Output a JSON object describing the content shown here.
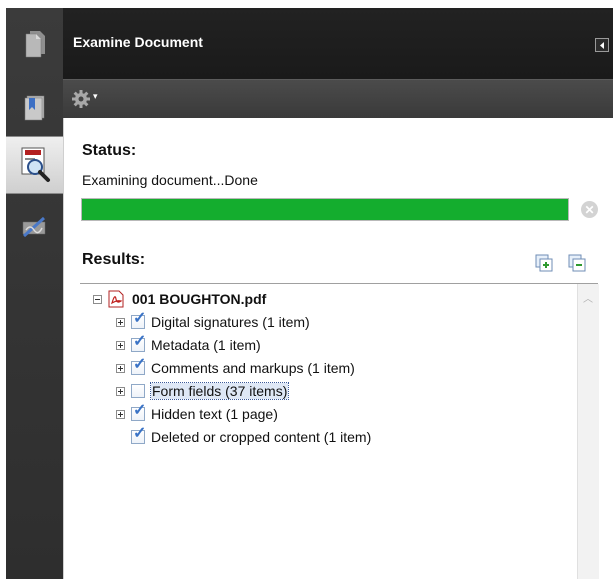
{
  "rail": {
    "items": [
      {
        "name": "page-thumbnails",
        "icon": "page-thumbnails-icon"
      },
      {
        "name": "bookmarks",
        "icon": "bookmarks-icon"
      },
      {
        "name": "examine-document",
        "icon": "examine-document-icon",
        "active": true
      },
      {
        "name": "signatures",
        "icon": "signatures-icon"
      }
    ]
  },
  "panel": {
    "title": "Examine Document",
    "collapse_icon": "collapse-arrow-icon",
    "options_icon": "gear-icon"
  },
  "status": {
    "label": "Status:",
    "message": "Examining document...Done",
    "progress": 1.0,
    "progress_color": "#14ad2e"
  },
  "results": {
    "label": "Results:",
    "expand_all_icon": "expand-all-icon",
    "collapse_all_icon": "collapse-all-icon",
    "file": {
      "name": "001 BOUGHTON.pdf",
      "icon": "pdf-file-icon",
      "expanded": true
    },
    "items": [
      {
        "label": "Digital signatures (1 item)",
        "checked": true,
        "expandable": true
      },
      {
        "label": "Metadata (1 item)",
        "checked": true,
        "expandable": true
      },
      {
        "label": "Comments and markups (1 item)",
        "checked": true,
        "expandable": true
      },
      {
        "label": "Form fields (37 items)",
        "checked": false,
        "expandable": true,
        "selected": true
      },
      {
        "label": "Hidden text (1 page)",
        "checked": true,
        "expandable": true
      },
      {
        "label": "Deleted or cropped content (1 item)",
        "checked": true,
        "expandable": false
      }
    ]
  }
}
